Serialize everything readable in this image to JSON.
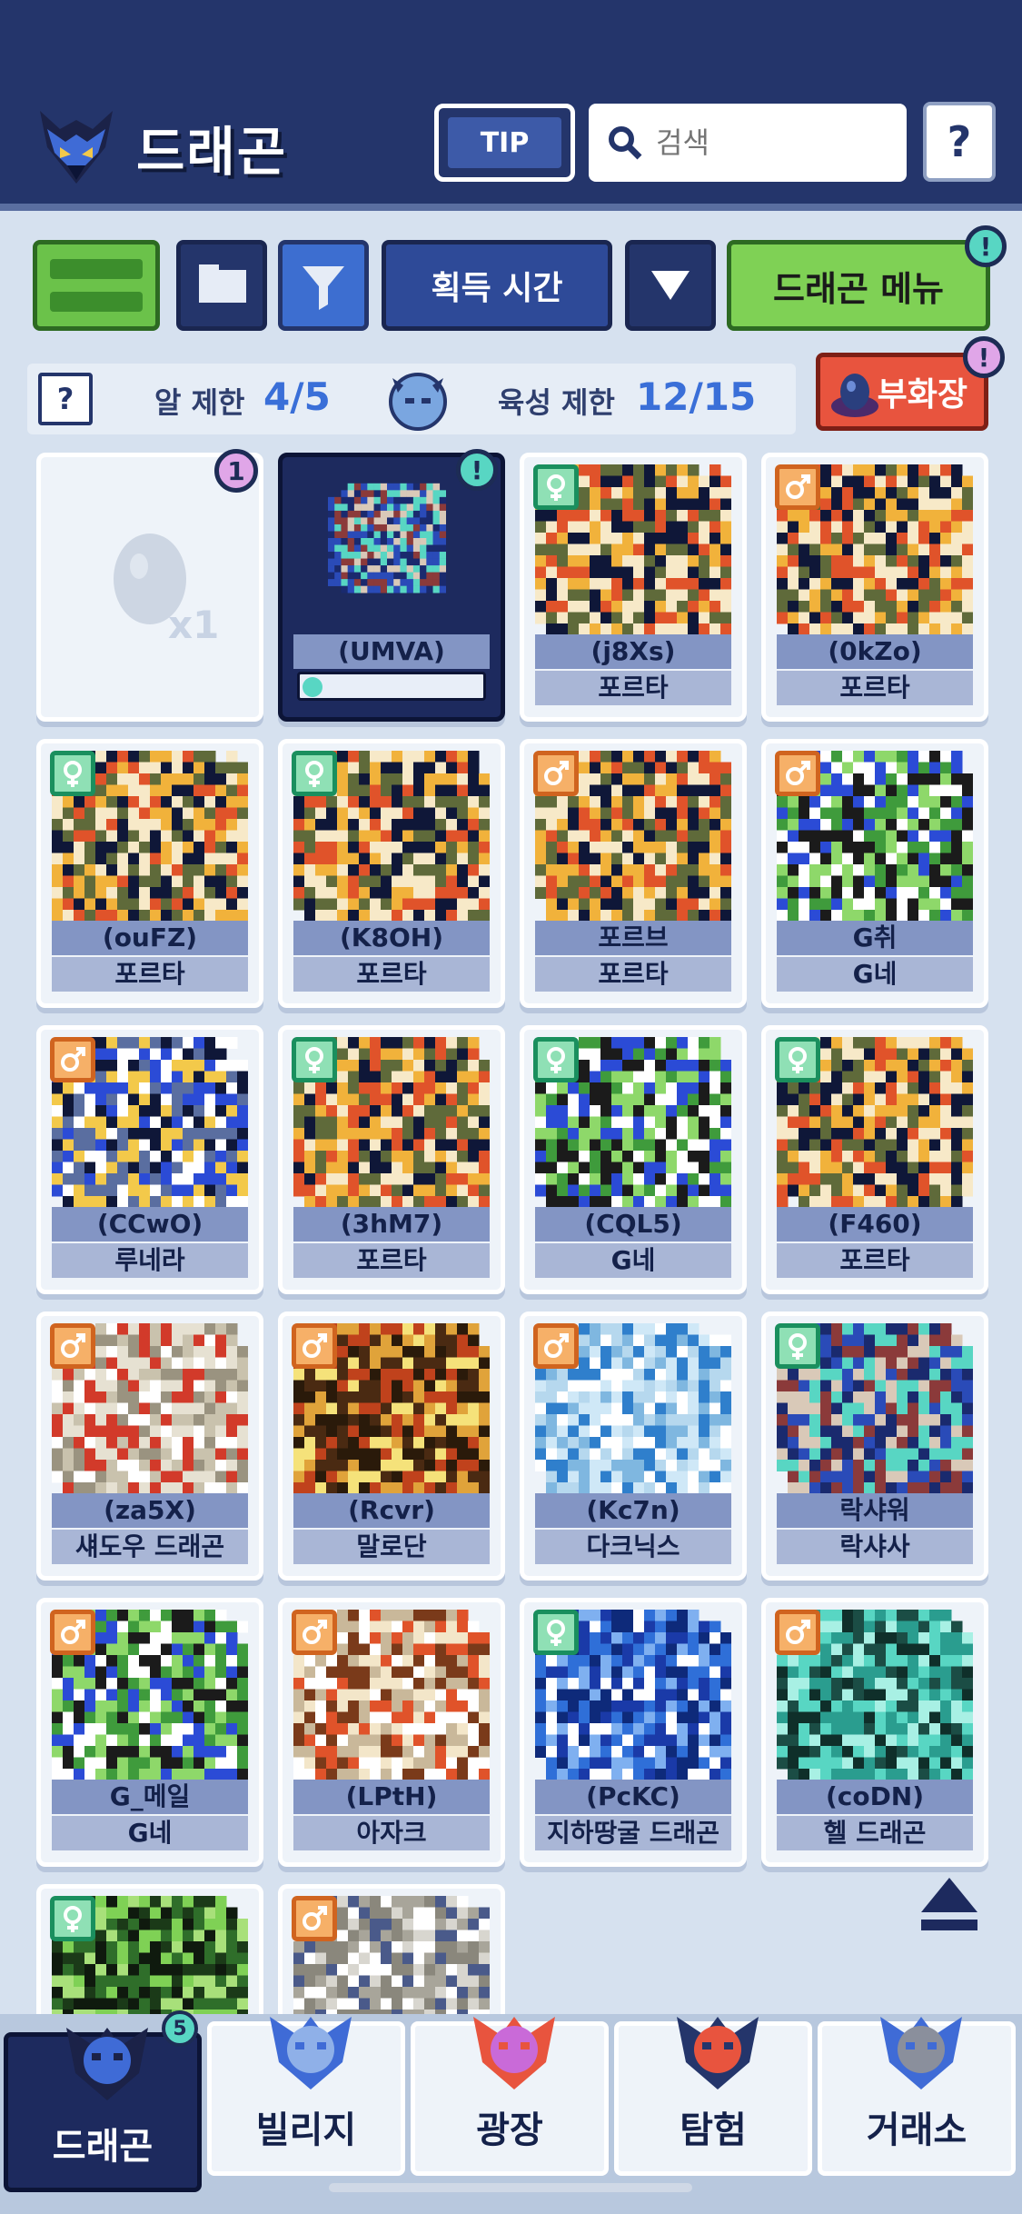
{
  "header": {
    "title": "드래곤",
    "tip_label": "TIP",
    "search_placeholder": "검색",
    "help_label": "?"
  },
  "toolbar": {
    "sort_label": "획득 시간",
    "menu_label": "드래곤 메뉴",
    "menu_badge": "!",
    "hatchery_label": "부화장",
    "hatchery_badge": "!"
  },
  "limits": {
    "help_label": "?",
    "egg_label": "알 제한",
    "egg_value": "4/5",
    "breed_label": "육성 제한",
    "breed_value": "12/15"
  },
  "egg_card": {
    "count": "x1",
    "badge": "1"
  },
  "selected_card": {
    "name": "(UMVA)",
    "badge": "!"
  },
  "dragons": [
    {
      "name": "(j8Xs)",
      "species": "포르타",
      "gender": "female",
      "palette": "porta"
    },
    {
      "name": "(0kZo)",
      "species": "포르타",
      "gender": "male",
      "palette": "porta"
    },
    {
      "name": "(ouFZ)",
      "species": "포르타",
      "gender": "female",
      "palette": "porta"
    },
    {
      "name": "(K8OH)",
      "species": "포르타",
      "gender": "female",
      "palette": "porta"
    },
    {
      "name": "포르브",
      "species": "포르타",
      "gender": "male",
      "palette": "porta"
    },
    {
      "name": "G취",
      "species": "G네",
      "gender": "male",
      "palette": "green"
    },
    {
      "name": "(CCwO)",
      "species": "루네라",
      "gender": "male",
      "palette": "lunera"
    },
    {
      "name": "(3hM7)",
      "species": "포르타",
      "gender": "female",
      "palette": "porta"
    },
    {
      "name": "(CQL5)",
      "species": "G네",
      "gender": "female",
      "palette": "green"
    },
    {
      "name": "(F460)",
      "species": "포르타",
      "gender": "female",
      "palette": "porta"
    },
    {
      "name": "(za5X)",
      "species": "섀도우 드래곤",
      "gender": "male",
      "palette": "shadow"
    },
    {
      "name": "(Rcvr)",
      "species": "말로단",
      "gender": "male",
      "palette": "malodan"
    },
    {
      "name": "(Kc7n)",
      "species": "다크닉스",
      "gender": "male",
      "palette": "ice"
    },
    {
      "name": "락샤워",
      "species": "락샤사",
      "gender": "female",
      "palette": "raksha"
    },
    {
      "name": "G_메일",
      "species": "G네",
      "gender": "male",
      "palette": "green"
    },
    {
      "name": "(LPtH)",
      "species": "아자크",
      "gender": "male",
      "palette": "azak"
    },
    {
      "name": "(PcKC)",
      "species": "지하땅굴 드래곤",
      "gender": "female",
      "palette": "blue"
    },
    {
      "name": "(coDN)",
      "species": "헬 드래곤",
      "gender": "male",
      "palette": "teal"
    }
  ],
  "partial_dragons": [
    {
      "gender": "female",
      "palette": "darkgreen"
    },
    {
      "gender": "male",
      "palette": "bone"
    }
  ],
  "nav": {
    "items": [
      {
        "label": "드래곤",
        "icon": "dragon-icon"
      },
      {
        "label": "빌리지",
        "icon": "village-icon"
      },
      {
        "label": "광장",
        "icon": "plaza-icon"
      },
      {
        "label": "탐험",
        "icon": "compass-icon"
      },
      {
        "label": "거래소",
        "icon": "exchange-icon"
      }
    ],
    "dragon_badge": "5"
  },
  "colors": {
    "header_bg": "#24356b",
    "accent_green": "#7fd155",
    "accent_red": "#e8543e",
    "accent_blue": "#3a6fd8",
    "badge_teal": "#58d6c3",
    "badge_pink": "#e0a6e8"
  }
}
